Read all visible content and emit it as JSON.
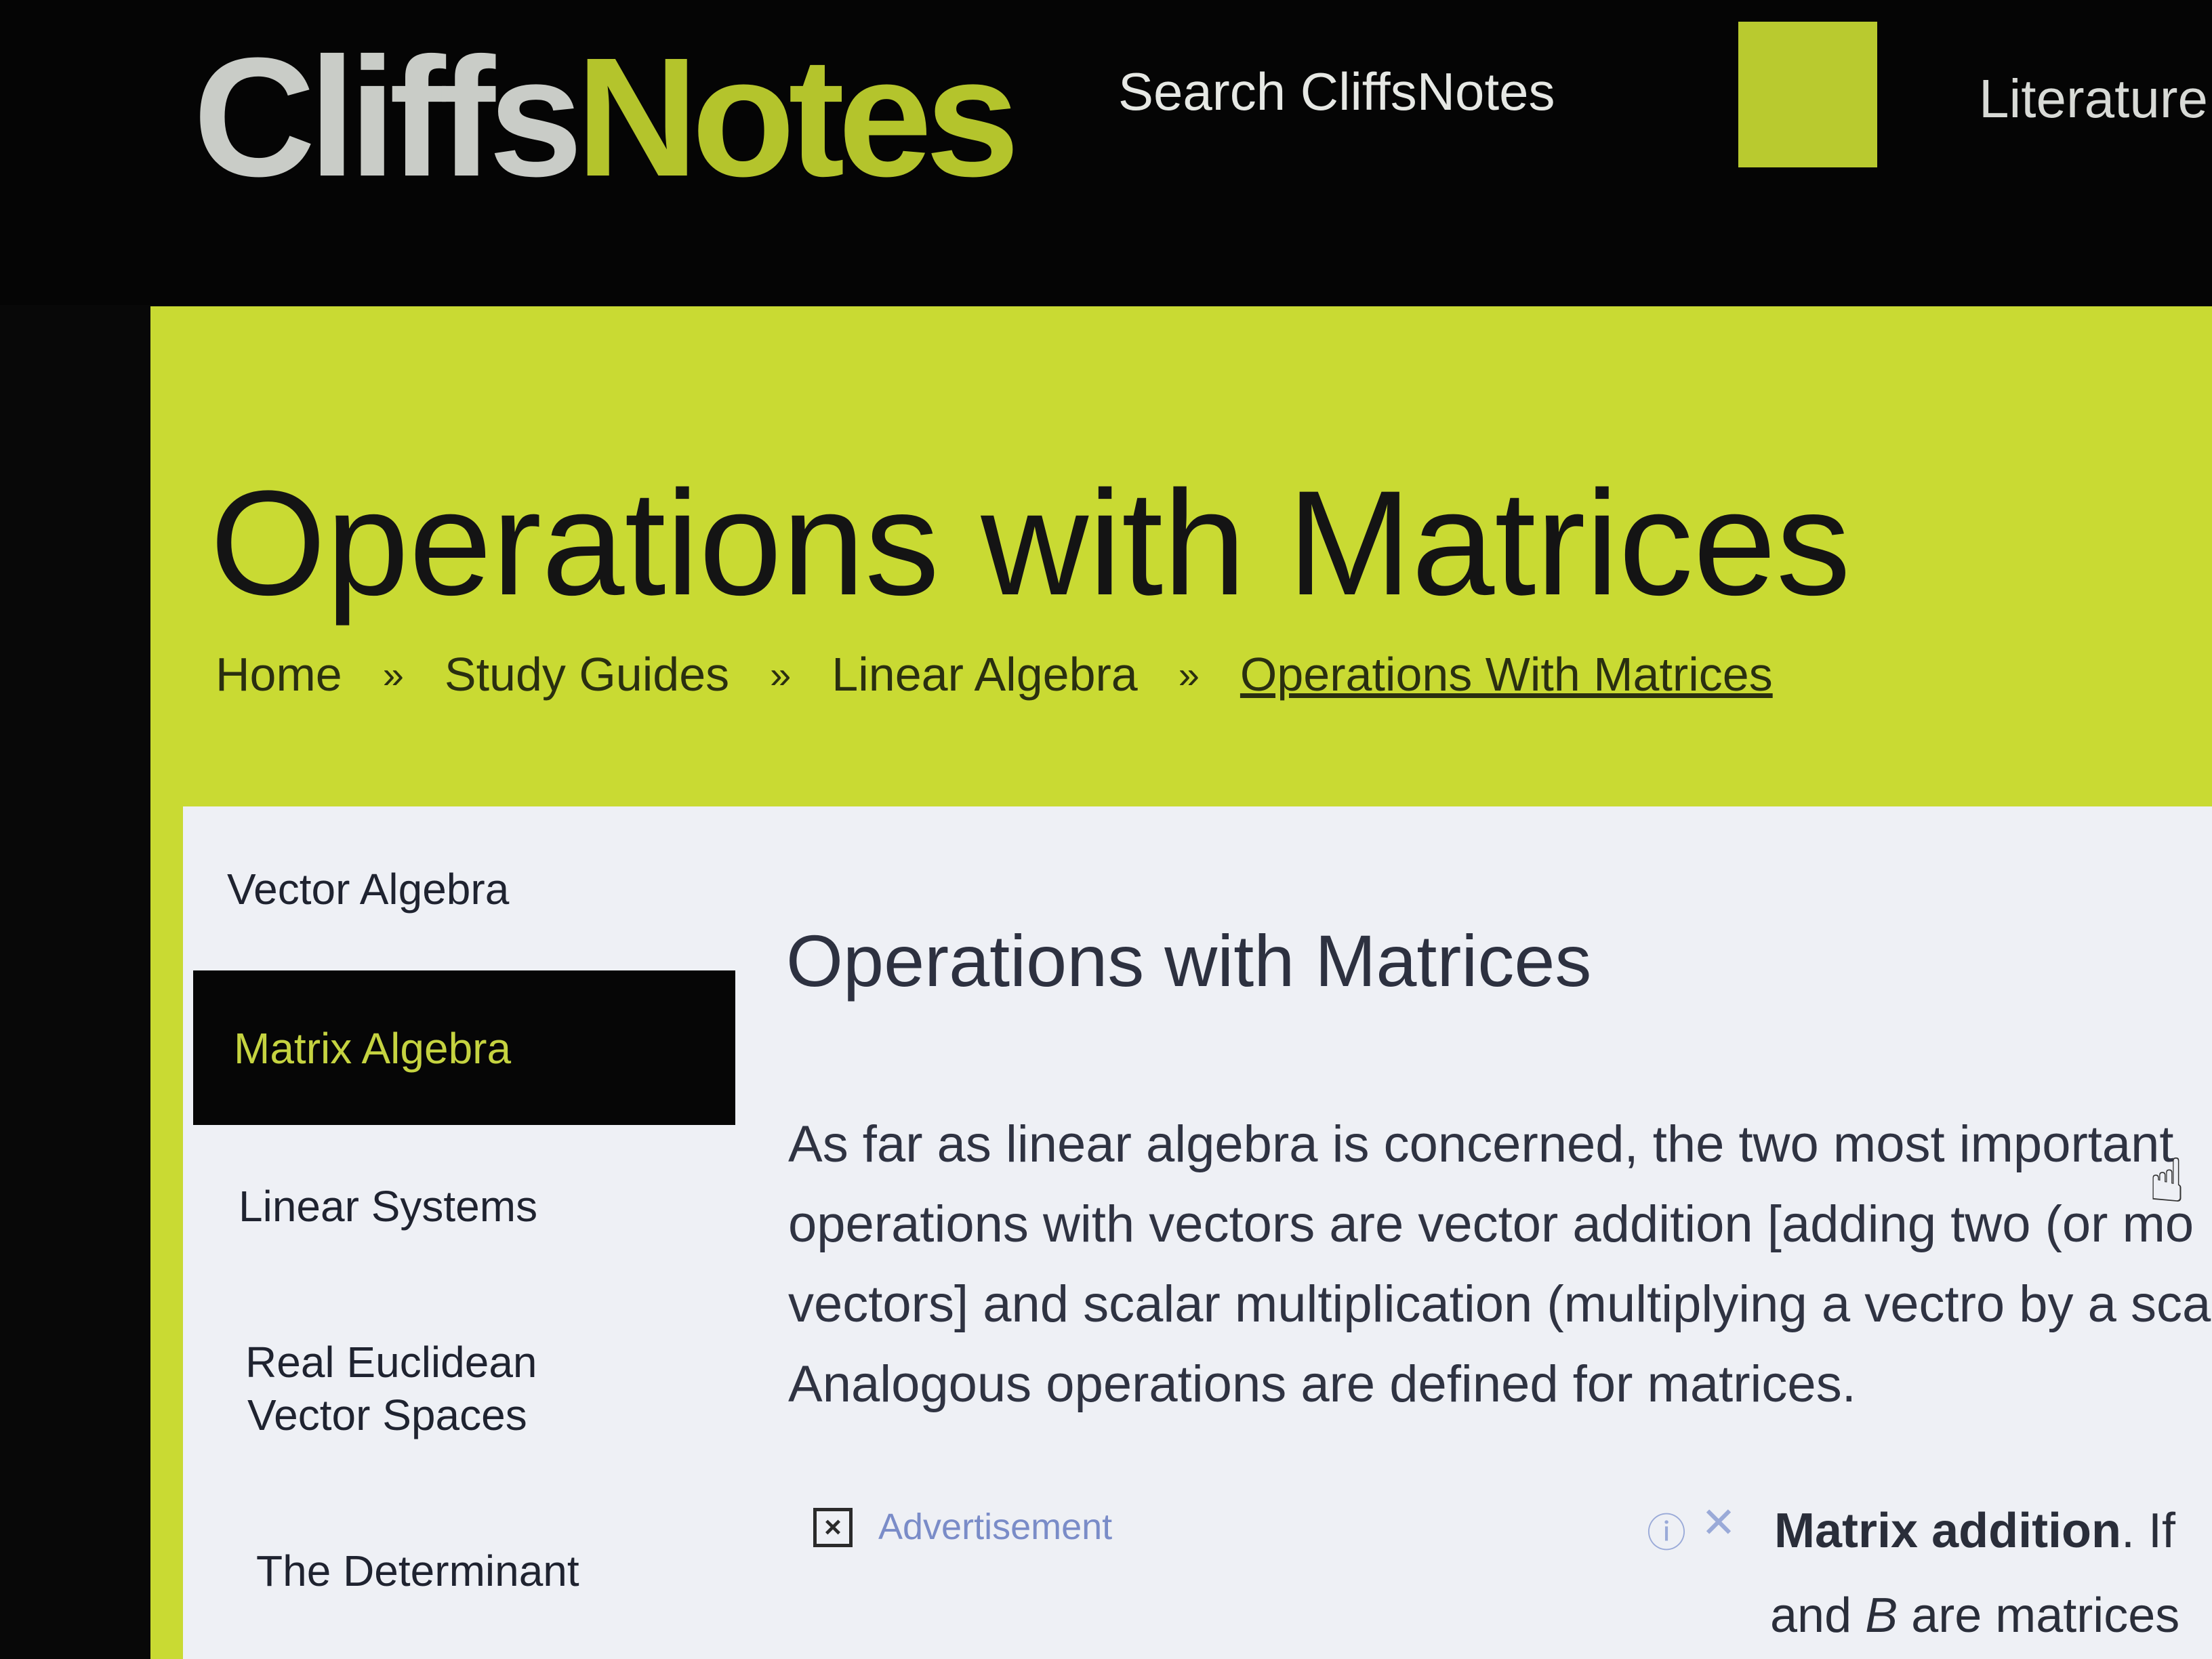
{
  "header": {
    "logo_part1": "Cliffs",
    "logo_part2": "Notes",
    "search_label": "Search CliffsNotes",
    "nav_item": "Literature"
  },
  "page": {
    "title": "Operations with Matrices",
    "breadcrumb": [
      "Home",
      "Study Guides",
      "Linear Algebra",
      "Operations With Matrices"
    ],
    "breadcrumb_separator": "»"
  },
  "sidebar": {
    "items": [
      {
        "label": "Vector Algebra"
      },
      {
        "label": "Matrix Algebra",
        "active": true
      },
      {
        "label": "Linear Systems"
      },
      {
        "label_line1": "Real Euclidean",
        "label_line2": "Vector Spaces"
      },
      {
        "label": "The Determinant"
      }
    ]
  },
  "main": {
    "heading": "Operations with Matrices",
    "paragraph_lines": [
      "As far as linear algebra is concerned, the two most important",
      "operations with vectors are vector addition [adding two (or mo",
      "vectors] and scalar multiplication (multiplying a vectro by a sca",
      "Analogous operations are defined for matrices."
    ],
    "ad_label": "Advertisement",
    "ad_info_symbol": "ⓘ",
    "ad_close_symbol": "✕",
    "next_bold": "Matrix addition",
    "next_rest": ". If",
    "next_line2_a": "and ",
    "next_line2_b": "B",
    "next_line2_c": " are matrices"
  },
  "colors": {
    "brand_yellow": "#c9da33",
    "header_bg": "#050505",
    "panel_bg": "#eef0f5",
    "active_text": "#c5d340"
  },
  "icons": [
    "search-button-icon",
    "ad-choices-icon",
    "info-icon",
    "close-icon",
    "hand-cursor-icon"
  ]
}
